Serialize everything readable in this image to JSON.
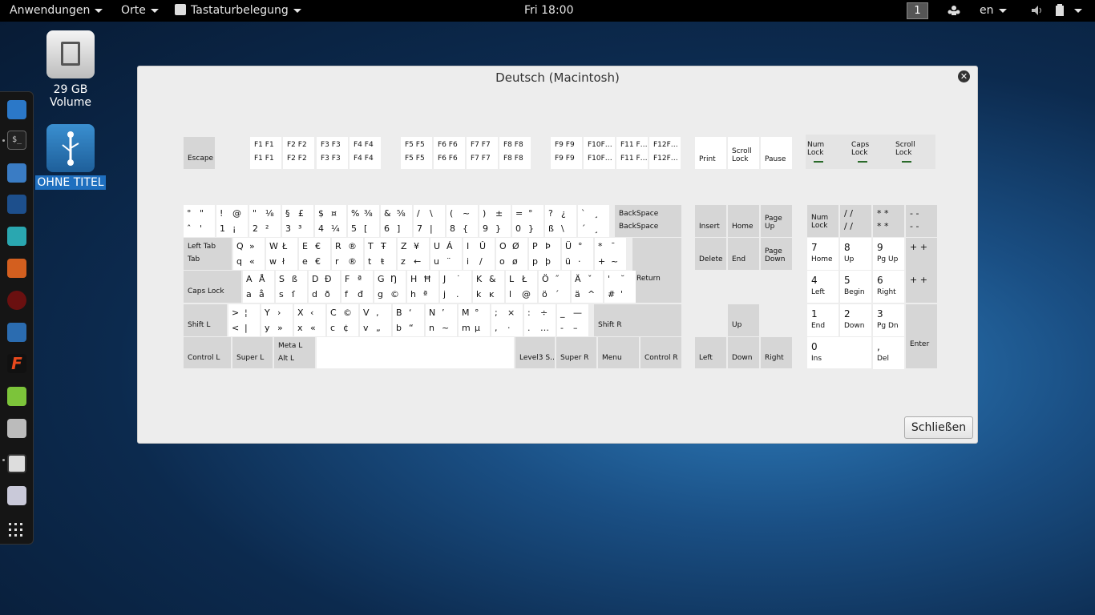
{
  "topbar": {
    "apps": "Anwendungen",
    "places": "Orte",
    "keyboard": "Tastaturbelegung",
    "clock": "Fri 18:00",
    "workspace": "1",
    "lang": "en"
  },
  "desktop": {
    "vol_label": "29 GB Volume",
    "usb_label": "OHNE TITEL"
  },
  "dialog": {
    "title": "Deutsch (Macintosh)",
    "close_label": "Schließen"
  },
  "keys": {
    "escape": "Escape",
    "f": [
      [
        "F1 F1",
        "F1 F1"
      ],
      [
        "F2 F2",
        "F2 F2"
      ],
      [
        "F3 F3",
        "F3 F3"
      ],
      [
        "F4 F4",
        "F4 F4"
      ],
      [
        "F5 F5",
        "F5 F5"
      ],
      [
        "F6 F6",
        "F6 F6"
      ],
      [
        "F7 F7",
        "F7 F7"
      ],
      [
        "F8 F8",
        "F8 F8"
      ],
      [
        "F9 F9",
        "F9 F9"
      ],
      [
        "F10F…",
        "F10F…"
      ],
      [
        "F11 F…",
        "F11 F…"
      ],
      [
        "F12F…",
        "F12F…"
      ]
    ],
    "print": "Print",
    "scroll": "Scroll Lock",
    "pause": "Pause",
    "leds": [
      "Num Lock",
      "Caps Lock",
      "Scroll Lock"
    ],
    "row1": [
      [
        "°",
        "\"",
        "ˆ",
        "'"
      ],
      [
        "!",
        "@",
        "1",
        "¡"
      ],
      [
        "\"",
        "⅛",
        "2",
        "²"
      ],
      [
        "§",
        "£",
        "3",
        "³"
      ],
      [
        "$",
        "¤",
        "4",
        "¼"
      ],
      [
        "%",
        "⅜",
        "5",
        "["
      ],
      [
        "&",
        "⅝",
        "6",
        "]"
      ],
      [
        "/",
        "\\",
        "7",
        "|"
      ],
      [
        "(",
        "~",
        "8",
        "{"
      ],
      [
        ")",
        "±",
        "9",
        "}"
      ],
      [
        "=",
        "°",
        "0",
        "}"
      ],
      [
        "?",
        "¿",
        "ß",
        "\\"
      ],
      [
        "`",
        "¸",
        "´",
        "¸"
      ]
    ],
    "backspace": "BackSpace",
    "row2": [
      [
        "Q",
        "»",
        "q",
        "«"
      ],
      [
        "W",
        "Ł",
        "w",
        "ł"
      ],
      [
        "E",
        "€",
        "e",
        "€"
      ],
      [
        "R",
        "®",
        "r",
        "®"
      ],
      [
        "T",
        "Ŧ",
        "t",
        "ŧ"
      ],
      [
        "Z",
        "¥",
        "z",
        "←"
      ],
      [
        "U",
        "Á",
        "u",
        "¨"
      ],
      [
        "I",
        "Û",
        "i",
        "/"
      ],
      [
        "O",
        "Ø",
        "o",
        "ø"
      ],
      [
        "P",
        "Þ",
        "p",
        "þ"
      ],
      [
        "Ü",
        "°",
        "ü",
        "·"
      ],
      [
        "*",
        "¯",
        "+",
        "~"
      ]
    ],
    "tab_top": "Left Tab",
    "tab_bot": "Tab",
    "return": "Return",
    "row3": [
      [
        "A",
        "Å",
        "a",
        "å"
      ],
      [
        "S",
        "ß",
        "s",
        "ſ"
      ],
      [
        "D",
        "Ð",
        "d",
        "ð"
      ],
      [
        "F",
        "ª",
        "f",
        "đ"
      ],
      [
        "G",
        "Ŋ",
        "g",
        "©"
      ],
      [
        "H",
        "Ħ",
        "h",
        "ª"
      ],
      [
        "J",
        "˙",
        "j",
        "."
      ],
      [
        "K",
        "&",
        "k",
        "ĸ"
      ],
      [
        "L",
        "Ł",
        "l",
        "@"
      ],
      [
        "Ö",
        "˝",
        "ö",
        "´"
      ],
      [
        "Ä",
        "ˇ",
        "ä",
        "^"
      ],
      [
        "'",
        "˘",
        "#",
        "'"
      ]
    ],
    "caps": "Caps Lock",
    "row4": [
      [
        ">",
        "¦",
        "<",
        "|"
      ],
      [
        "Y",
        "›",
        "y",
        "»"
      ],
      [
        "X",
        "‹",
        "x",
        "«"
      ],
      [
        "C",
        "©",
        "c",
        "¢"
      ],
      [
        "V",
        "‚",
        "v",
        "„"
      ],
      [
        "B",
        "‘",
        "b",
        "“"
      ],
      [
        "N",
        "’",
        "n",
        "~"
      ],
      [
        "M",
        "°",
        "m",
        "µ"
      ],
      [
        ";",
        "×",
        ",",
        "·"
      ],
      [
        ":",
        "÷",
        ".",
        "…"
      ],
      [
        "_",
        "—",
        "-",
        "–"
      ]
    ],
    "shiftl": "Shift L",
    "shiftr": "Shift R",
    "controll": "Control L",
    "superl": "Super L",
    "meta_top": "Meta L",
    "meta_bot": "Alt L",
    "level3": "Level3 S…",
    "superr": "Super R",
    "menu": "Menu",
    "controlr": "Control R",
    "insert": "Insert",
    "home": "Home",
    "pageup": "Page Up",
    "delete": "Delete",
    "end": "End",
    "pagedown": "Page Down",
    "up": "Up",
    "left": "Left",
    "down": "Down",
    "right": "Right",
    "numlock": "Num Lock",
    "np": [
      [
        "/ /",
        "/ /"
      ],
      [
        "* *",
        "* *"
      ],
      [
        "- -",
        "- -"
      ]
    ],
    "np7": [
      "7",
      "Home"
    ],
    "np8": [
      "8",
      "Up"
    ],
    "np9": [
      "9",
      "Pg Up"
    ],
    "npplus": "+ +",
    "np4": [
      "4",
      "Left"
    ],
    "np5": [
      "5",
      "Begin"
    ],
    "np6": [
      "6",
      "Right"
    ],
    "npplus2": "+ +",
    "np1": [
      "1",
      "End"
    ],
    "np2": [
      "2",
      "Down"
    ],
    "np3": [
      "3",
      "Pg Dn"
    ],
    "enter": "Enter",
    "np0": [
      "0",
      "Ins"
    ],
    "npdel": [
      ",",
      "Del"
    ]
  },
  "colors": {
    "accent": "#2a6a2a",
    "topbar": "#000000",
    "dialog_bg": "#ededed"
  }
}
